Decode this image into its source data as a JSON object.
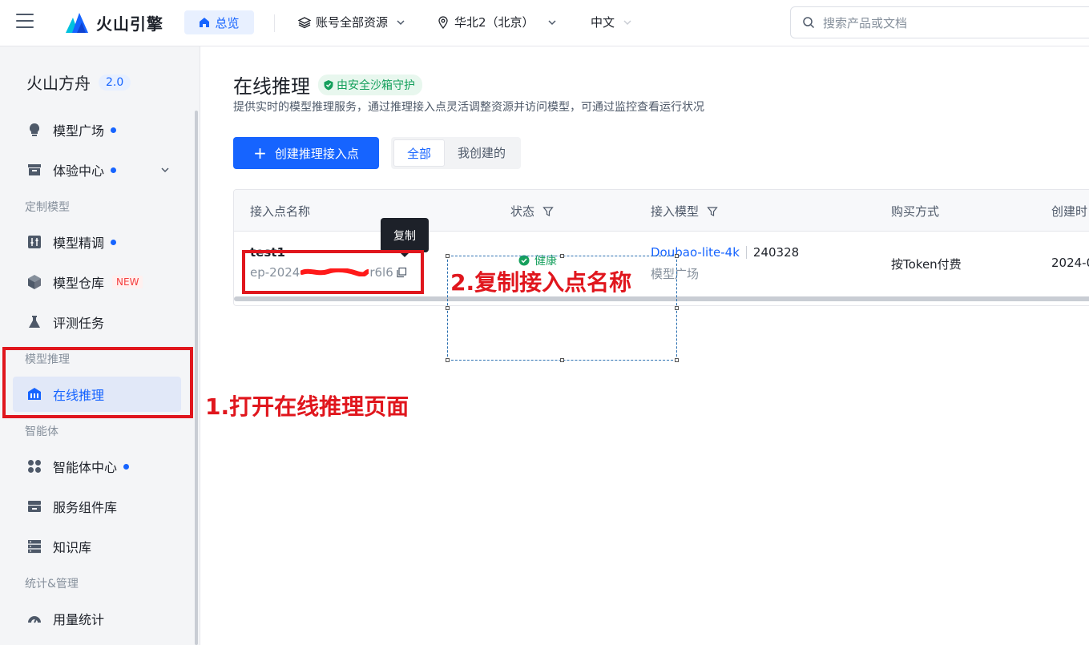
{
  "header": {
    "logo_text": "火山引擎",
    "overview_label": "总览",
    "account_label": "账号全部资源",
    "region_label": "华北2（北京）",
    "language_label": "中文",
    "search_placeholder": "搜索产品或文档"
  },
  "sidebar": {
    "product_name": "火山方舟",
    "version": "2.0",
    "items": {
      "model_square": "模型广场",
      "experience_center": "体验中心",
      "group_custom": "定制模型",
      "fine_tune": "模型精调",
      "repository": "模型仓库",
      "new_tag": "NEW",
      "evaluation": "评测任务",
      "group_inference": "模型推理",
      "online_inference": "在线推理",
      "group_agent": "智能体",
      "agent_center": "智能体中心",
      "service_components": "服务组件库",
      "knowledge_base": "知识库",
      "group_stats": "统计&管理",
      "usage_stats": "用量统计"
    }
  },
  "main": {
    "title": "在线推理",
    "sandbox_tag": "由安全沙箱守护",
    "description": "提供实时的模型推理服务，通过推理接入点灵活调整资源并访问模型，可通过监控查看运行状况",
    "create_button": "创建推理接入点",
    "filter_all": "全部",
    "filter_mine": "我创建的",
    "table": {
      "columns": {
        "name": "接入点名称",
        "status": "状态",
        "model": "接入模型",
        "purchase": "购买方式",
        "created": "创建时"
      },
      "row": {
        "name": "test1",
        "id_prefix": "ep-2024",
        "id_suffix": "r6l6",
        "status": "健康",
        "model_name": "Doubao-lite-4k",
        "model_version": "240328",
        "model_source": "模型广场",
        "purchase": "按Token付费",
        "created": "2024-0"
      }
    },
    "tooltip": "复制"
  },
  "annotations": {
    "step1": "1.打开在线推理页面",
    "step2": "2.复制接入点名称"
  },
  "colors": {
    "brand": "#1664ff",
    "annotation": "#e0161d",
    "healthy": "#16a05d"
  }
}
